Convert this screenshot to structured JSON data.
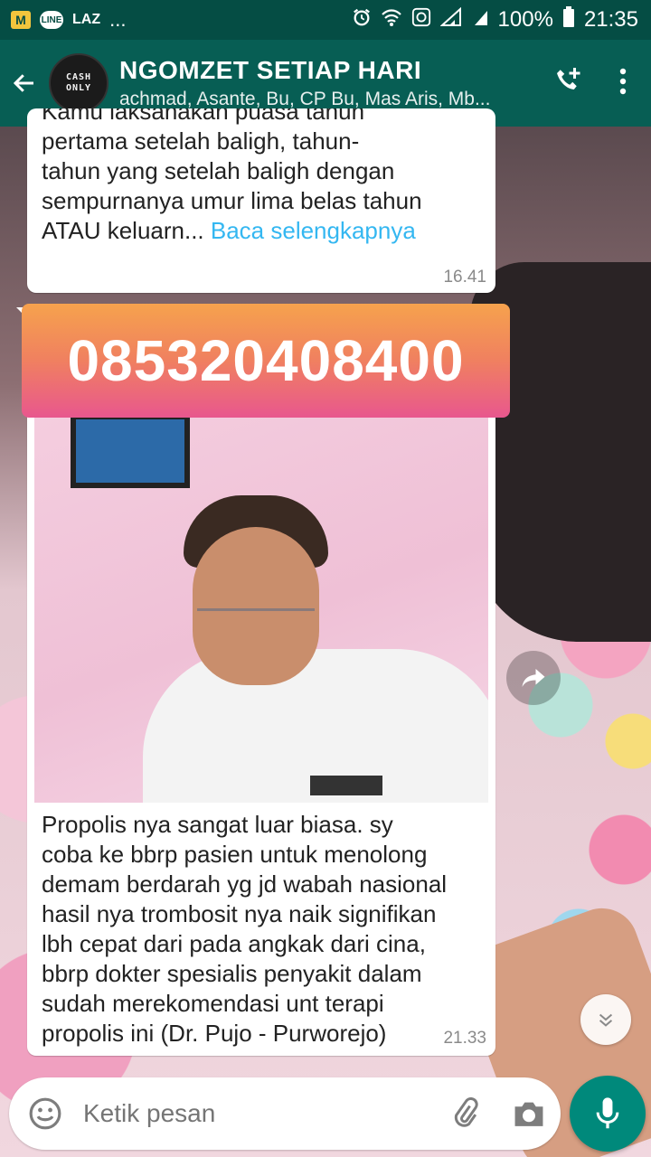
{
  "status_bar": {
    "left_icons": [
      "M",
      "LINE",
      "LAZ"
    ],
    "more": "...",
    "battery": "100%",
    "time": "21:35"
  },
  "header": {
    "title": "NGOMZET SETIAP HARI",
    "subtitle": "achmad, Asante, Bu, CP Bu, Mas Aris, Mb...",
    "avatar_text_line1": "CASH",
    "avatar_text_line2": "ONLY"
  },
  "messages": [
    {
      "partial_first_line": "Kamu laksanakan puasa tahun",
      "lines": [
        "pertama setelah baligh, tahun-",
        "tahun yang setelah baligh dengan",
        "sempurnanya umur lima belas tahun"
      ],
      "last_line": "ATAU keluarn... ",
      "read_more": "Baca selengkapnya",
      "time": "16.41"
    },
    {
      "banner_number": "085320408400",
      "caption_lines": [
        "Propolis nya sangat luar biasa. sy",
        "coba ke bbrp pasien untuk menolong",
        "demam berdarah yg jd wabah nasional",
        "hasil nya trombosit nya naik signifikan",
        "lbh cepat dari pada angkak dari cina,",
        "bbrp dokter spesialis penyakit dalam",
        "sudah merekomendasi unt terapi",
        "propolis ini (Dr. Pujo - Purworejo)"
      ],
      "time": "21.33"
    }
  ],
  "composer": {
    "placeholder": "Ketik pesan"
  },
  "colors": {
    "status_bar": "#054d44",
    "toolbar": "#075e54",
    "mic_button": "#00897b",
    "link": "#34b7f1"
  },
  "icons": [
    "back-arrow-icon",
    "add-call-icon",
    "more-vert-icon",
    "forward-icon",
    "scroll-down-icon",
    "emoji-icon",
    "attach-icon",
    "camera-icon",
    "mic-icon"
  ]
}
